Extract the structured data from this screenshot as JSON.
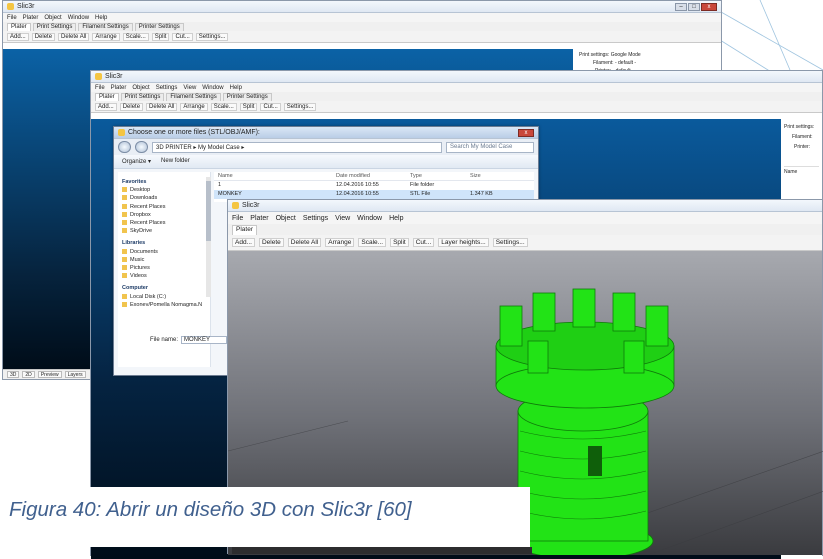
{
  "win1": {
    "title": "Slic3r",
    "menu": [
      "File",
      "Plater",
      "Object",
      "Window",
      "Help"
    ],
    "tabs": [
      "Plater",
      "Print Settings",
      "Filament Settings",
      "Printer Settings"
    ],
    "toolbar": [
      "Add...",
      "Delete",
      "Delete All",
      "Arrange",
      "Scale...",
      "Split",
      "Cut...",
      "Settings..."
    ],
    "side": {
      "print_settings_label": "Print settings:",
      "print_settings_value": "Google Mode",
      "filament_label": "Filament:",
      "filament_value": "- default -",
      "printer_label": "Printer:",
      "printer_value": "- default -"
    },
    "footer": [
      "3D",
      "2D",
      "Preview",
      "Layers"
    ]
  },
  "win2": {
    "title": "Slic3r",
    "menu": [
      "File",
      "Plater",
      "Object",
      "Settings",
      "View",
      "Window",
      "Help"
    ],
    "tabs": [
      "Plater",
      "Print Settings",
      "Filament Settings",
      "Printer Settings"
    ],
    "toolbar": [
      "Add...",
      "Delete",
      "Delete All",
      "Arrange",
      "Scale...",
      "Split",
      "Cut...",
      "Settings..."
    ],
    "side": {
      "print_settings_label": "Print settings:",
      "filament_label": "Filament:",
      "printer_label": "Printer:",
      "name_col": "Name"
    }
  },
  "dialog": {
    "title": "Choose one or more files (STL/OBJ/AMF):",
    "path": "3D PRINTER ▸ My Model Case ▸",
    "search_placeholder": "Search My Model Case",
    "organize": "Organize ▾",
    "new_folder": "New folder",
    "nav_favorites": "Favorites",
    "nav_fav_items": [
      "Desktop",
      "Downloads",
      "Recent Places",
      "Dropbox",
      "Recent Places",
      "SkyDrive"
    ],
    "nav_libraries": "Libraries",
    "nav_lib_items": [
      "Documents",
      "Music",
      "Pictures",
      "Videos"
    ],
    "nav_computer": "Computer",
    "nav_comp_items": [
      "Local Disk (C:)",
      "Exonev/Pomella Nomagma.N"
    ],
    "columns": [
      "Name",
      "Date modified",
      "Type",
      "Size"
    ],
    "rows": [
      {
        "name": "1",
        "date": "12.04.2016 10:55",
        "type": "File folder",
        "size": ""
      },
      {
        "name": "MONKEY",
        "date": "12.04.2016 10:55",
        "type": "STL File",
        "size": "1.347 KB"
      }
    ],
    "filename_label": "File name:",
    "filename_value": "MONKEY"
  },
  "win4": {
    "title": "Slic3r",
    "menu": [
      "File",
      "Plater",
      "Object",
      "Settings",
      "View",
      "Window",
      "Help"
    ],
    "tabs": [
      "Plater"
    ],
    "toolbar": [
      "Add...",
      "Delete",
      "Delete All",
      "Arrange",
      "Scale...",
      "Split",
      "Cut...",
      "Layer heights...",
      "Settings..."
    ]
  },
  "caption": "Figura 40: Abrir un diseño 3D con Slic3r [60]",
  "colors": {
    "model_green": "#22e316",
    "canvas_blue": "#0a5a9c",
    "caption_blue": "#40608e"
  }
}
